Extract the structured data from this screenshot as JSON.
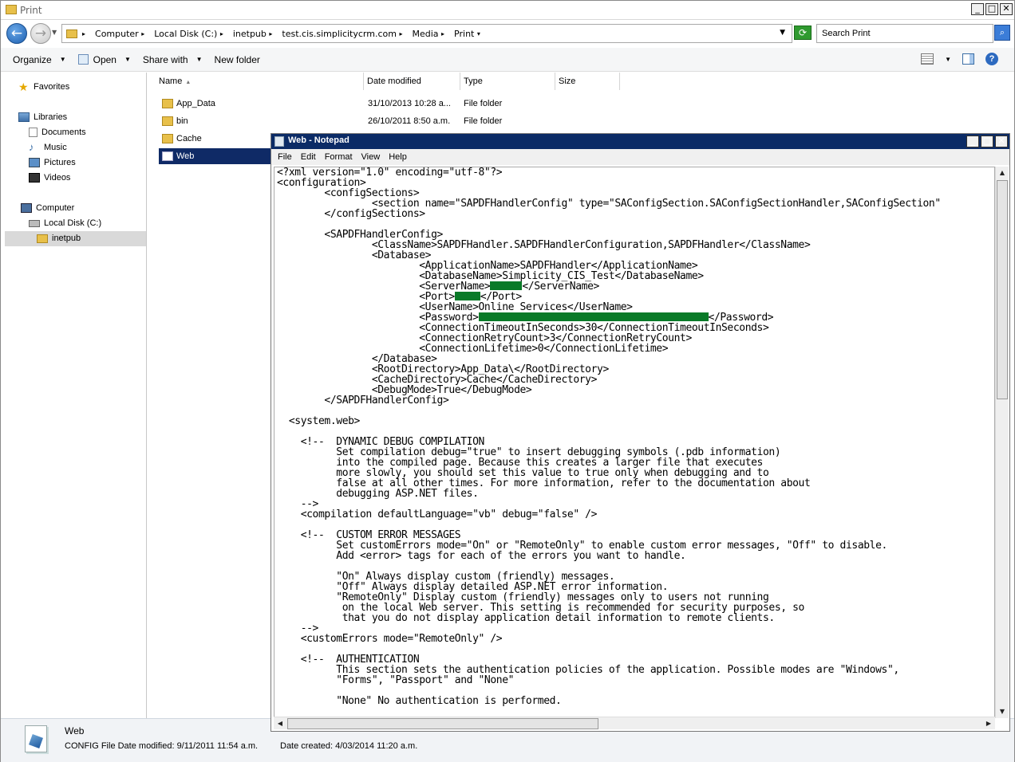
{
  "explorer": {
    "title": "Print",
    "breadcrumbs": [
      "Computer",
      "Local Disk (C:)",
      "inetpub",
      "test.cis.simplicitycrm.com",
      "Media",
      "Print"
    ],
    "search_placeholder": "Search Print",
    "toolbar": {
      "organize": "Organize",
      "open": "Open",
      "share_with": "Share with",
      "new_folder": "New folder"
    },
    "nav": {
      "favorites": "Favorites",
      "libraries": "Libraries",
      "documents": "Documents",
      "music": "Music",
      "pictures": "Pictures",
      "videos": "Videos",
      "computer": "Computer",
      "local_disk": "Local Disk (C:)",
      "inetpub": "inetpub"
    },
    "columns": {
      "name": "Name",
      "date_modified": "Date modified",
      "type": "Type",
      "size": "Size"
    },
    "files": [
      {
        "name": "App_Data",
        "date": "31/10/2013 10:28 a...",
        "type": "File folder"
      },
      {
        "name": "bin",
        "date": "26/10/2011 8:50 a.m.",
        "type": "File folder"
      },
      {
        "name": "Cache",
        "date": "",
        "type": ""
      },
      {
        "name": "Web",
        "date": "",
        "type": ""
      }
    ],
    "details": {
      "name": "Web",
      "meta": "CONFIG File Date modified: 9/11/2011 11:54 a.m.",
      "created": "Date created: 4/03/2014 11:20 a.m."
    }
  },
  "notepad": {
    "title": "Web - Notepad",
    "menus": [
      "File",
      "Edit",
      "Format",
      "View",
      "Help"
    ],
    "lines": {
      "l01": "<?xml version=\"1.0\" encoding=\"utf-8\"?>",
      "l02": "<configuration>",
      "l03": "        <configSections>",
      "l04": "                <section name=\"SAPDFHandlerConfig\" type=\"SAConfigSection.SAConfigSectionHandler,SAConfigSection\"",
      "l05": "        </configSections>",
      "l06": "",
      "l07": "        <SAPDFHandlerConfig>",
      "l08": "                <ClassName>SAPDFHandler.SAPDFHandlerConfiguration,SAPDFHandler</ClassName>",
      "l09": "                <Database>",
      "l10": "                        <ApplicationName>SAPDFHandler</ApplicationName>",
      "l11": "                        <DatabaseName>Simplicity_CIS_Test</DatabaseName>",
      "l12a": "                        <ServerName>",
      "l12b": "</ServerName>",
      "l13a": "                        <Port>",
      "l13b": "</Port>",
      "l14": "                        <UserName>Online Services</UserName>",
      "l15a": "                        <Password>",
      "l15b": "</Password>",
      "l16": "                        <ConnectionTimeoutInSeconds>30</ConnectionTimeoutInSeconds>",
      "l17": "                        <ConnectionRetryCount>3</ConnectionRetryCount>",
      "l18": "                        <ConnectionLifetime>0</ConnectionLifetime>",
      "l19": "                </Database>",
      "l20": "                <RootDirectory>App_Data\\</RootDirectory>",
      "l21": "                <CacheDirectory>Cache</CacheDirectory>",
      "l22": "                <DebugMode>True</DebugMode>",
      "l23": "        </SAPDFHandlerConfig>",
      "l24": "",
      "l25": "  <system.web>",
      "l26": "",
      "l27": "    <!--  DYNAMIC DEBUG COMPILATION",
      "l28": "          Set compilation debug=\"true\" to insert debugging symbols (.pdb information)",
      "l29": "          into the compiled page. Because this creates a larger file that executes",
      "l30": "          more slowly, you should set this value to true only when debugging and to",
      "l31": "          false at all other times. For more information, refer to the documentation about",
      "l32": "          debugging ASP.NET files.",
      "l33": "    -->",
      "l34": "    <compilation defaultLanguage=\"vb\" debug=\"false\" />",
      "l35": "",
      "l36": "    <!--  CUSTOM ERROR MESSAGES",
      "l37": "          Set customErrors mode=\"On\" or \"RemoteOnly\" to enable custom error messages, \"Off\" to disable.",
      "l38": "          Add <error> tags for each of the errors you want to handle.",
      "l39": "",
      "l40": "          \"On\" Always display custom (friendly) messages.",
      "l41": "          \"Off\" Always display detailed ASP.NET error information.",
      "l42": "          \"RemoteOnly\" Display custom (friendly) messages only to users not running",
      "l43": "           on the local Web server. This setting is recommended for security purposes, so",
      "l44": "           that you do not display application detail information to remote clients.",
      "l45": "    -->",
      "l46": "    <customErrors mode=\"RemoteOnly\" />",
      "l47": "",
      "l48": "    <!--  AUTHENTICATION",
      "l49": "          This section sets the authentication policies of the application. Possible modes are \"Windows\",",
      "l50": "          \"Forms\", \"Passport\" and \"None\"",
      "l51": "",
      "l52": "          \"None\" No authentication is performed."
    }
  }
}
